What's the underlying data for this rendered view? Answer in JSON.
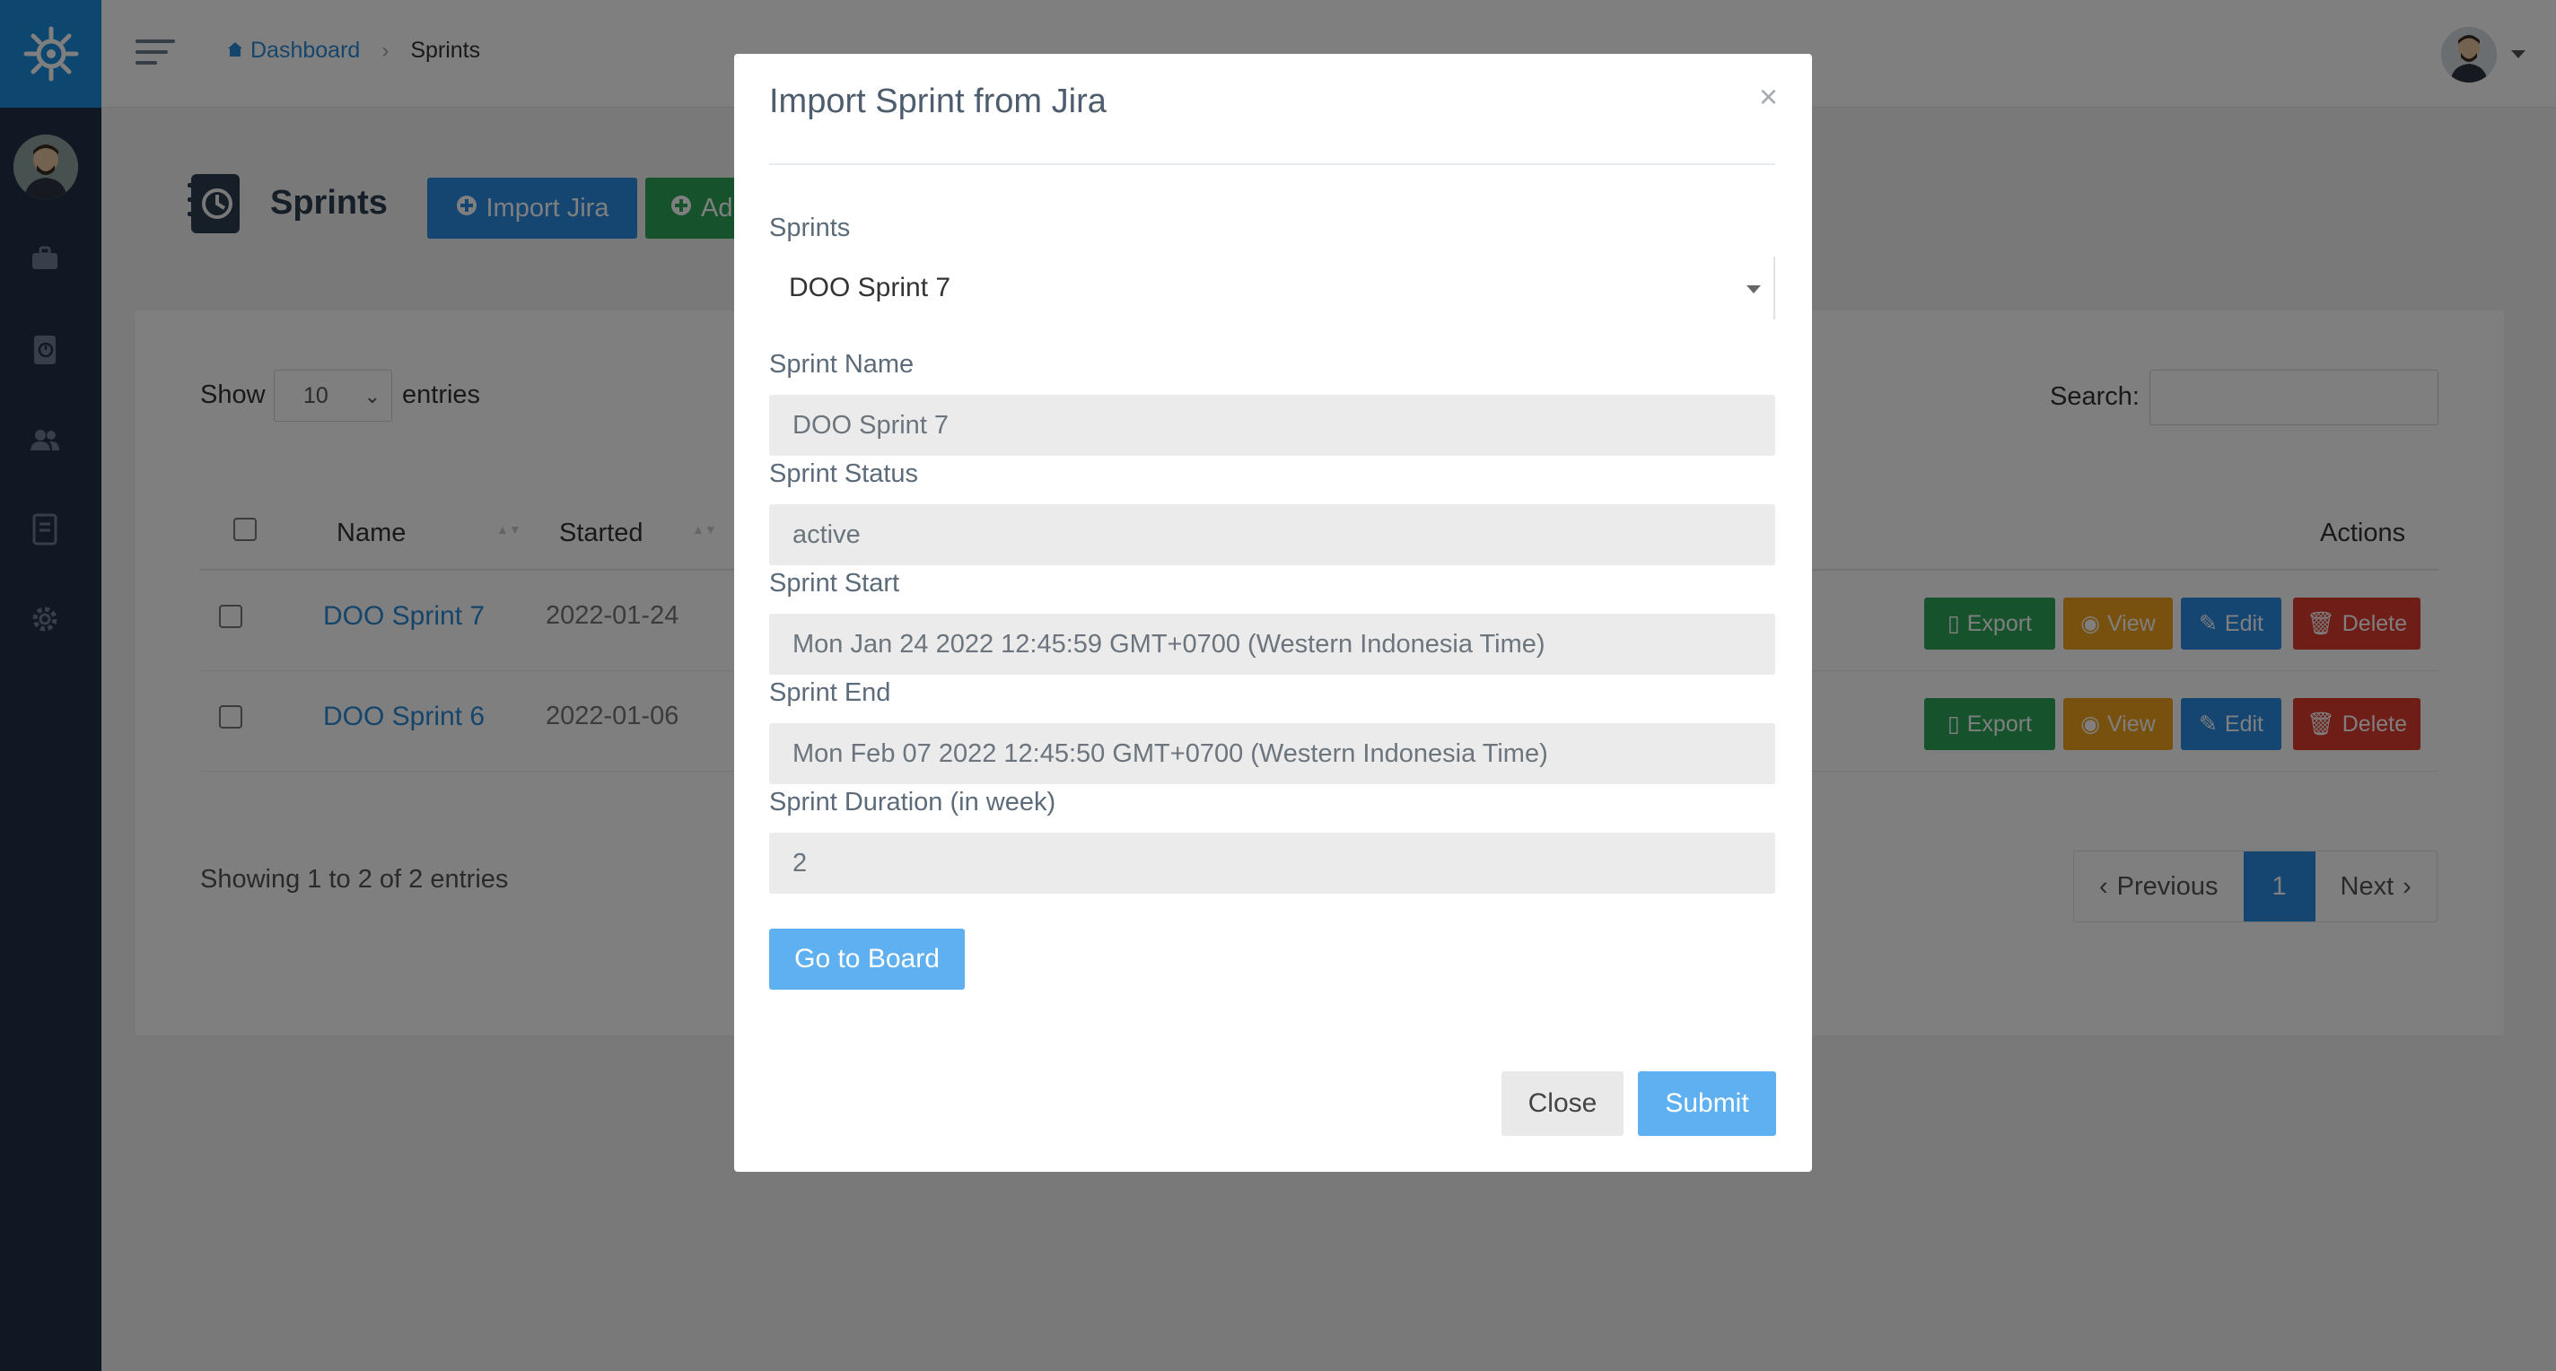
{
  "colors": {
    "sidebar_bg": "#1f3146",
    "logo_bg": "#1b8fe0",
    "primary": "#2a8be3",
    "success": "#2ca65a",
    "warning": "#f0a21d",
    "danger": "#dd3b2f",
    "modal_primary": "#5fb0f0"
  },
  "sidebar": {
    "icons": [
      "helm-logo-icon",
      "briefcase-icon",
      "sprint-book-icon",
      "users-icon",
      "document-icon",
      "gear-icon"
    ]
  },
  "breadcrumb": {
    "home": "Dashboard",
    "separator": "›",
    "current": "Sprints"
  },
  "page": {
    "title": "Sprints",
    "import_button": "Import Jira",
    "add_button": "Ad"
  },
  "table_controls": {
    "show_label": "Show",
    "page_size": "10",
    "entries_label": "entries",
    "search_label": "Search:"
  },
  "table": {
    "columns": [
      "Name",
      "Started",
      "Actions"
    ],
    "rows": [
      {
        "name": "DOO Sprint 7",
        "started": "2022-01-24"
      },
      {
        "name": "DOO Sprint 6",
        "started": "2022-01-06"
      }
    ],
    "actions": {
      "export": "Export",
      "view": "View",
      "edit": "Edit",
      "delete": "Delete"
    }
  },
  "footer": {
    "info": "Showing 1 to 2 of 2 entries",
    "previous": "Previous",
    "current_page": "1",
    "next": "Next"
  },
  "modal": {
    "title": "Import Sprint from Jira",
    "close_symbol": "×",
    "sprints_label": "Sprints",
    "sprints_selected": "DOO Sprint 7",
    "fields": [
      {
        "label": "Sprint Name",
        "value": "DOO Sprint 7"
      },
      {
        "label": "Sprint Status",
        "value": "active"
      },
      {
        "label": "Sprint Start",
        "value": "Mon Jan 24 2022 12:45:59 GMT+0700 (Western Indonesia Time)"
      },
      {
        "label": "Sprint End",
        "value": "Mon Feb 07 2022 12:45:50 GMT+0700 (Western Indonesia Time)"
      },
      {
        "label": "Sprint Duration (in week)",
        "value": "2"
      }
    ],
    "board_button": "Go to Board",
    "close_button": "Close",
    "submit_button": "Submit"
  }
}
